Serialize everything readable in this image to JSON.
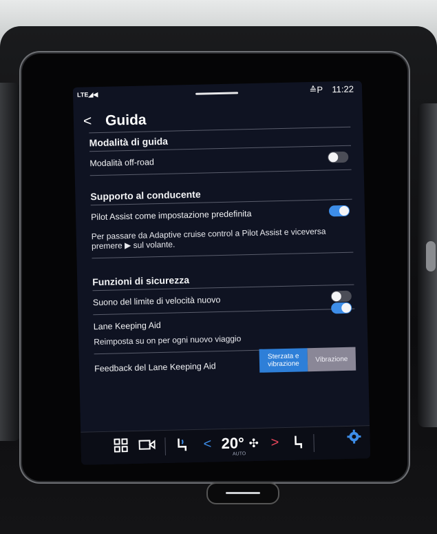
{
  "status_bar": {
    "signal": "LTE◢◀",
    "indicator": "≙P",
    "time": "11:22"
  },
  "header": {
    "back_icon": "chevron-left-icon",
    "title": "Guida"
  },
  "sections": {
    "driving_mode": {
      "title": "Modalità di guida",
      "offroad_label": "Modalità off-road",
      "offroad_on": false
    },
    "driver_support": {
      "title": "Supporto al conducente",
      "pilot_assist_label": "Pilot Assist come impostazione predefinita",
      "pilot_assist_on": true,
      "pilot_assist_desc": "Per passare da Adaptive cruise control a Pilot Assist e viceversa premere ▶ sul volante."
    },
    "safety": {
      "title": "Funzioni di sicurezza",
      "speed_limit_sound_label": "Suono del limite di velocità nuovo",
      "speed_limit_sound_on": false,
      "lane_keeping_label": "Lane Keeping Aid",
      "lane_keeping_on": true,
      "lane_keeping_desc": "Reimposta su on per ogni nuovo viaggio",
      "feedback_label": "Feedback del Lane Keeping Aid",
      "feedback_options": [
        "Sterzata e vibrazione",
        "Vibrazione"
      ],
      "feedback_selected": "Sterzata e vibrazione"
    }
  },
  "climate_bar": {
    "temp": "20°",
    "mode": "AUTO",
    "icons": [
      "grid-icon",
      "camera-icon",
      "seat-heat-icon",
      "chevron-left-icon",
      "fan-icon",
      "chevron-right-icon",
      "seat-icon",
      "settings-icon"
    ]
  },
  "colors": {
    "accent": "#3d8de8",
    "screen_bg": "#0f1322",
    "segment_inactive": "#8a8797"
  }
}
